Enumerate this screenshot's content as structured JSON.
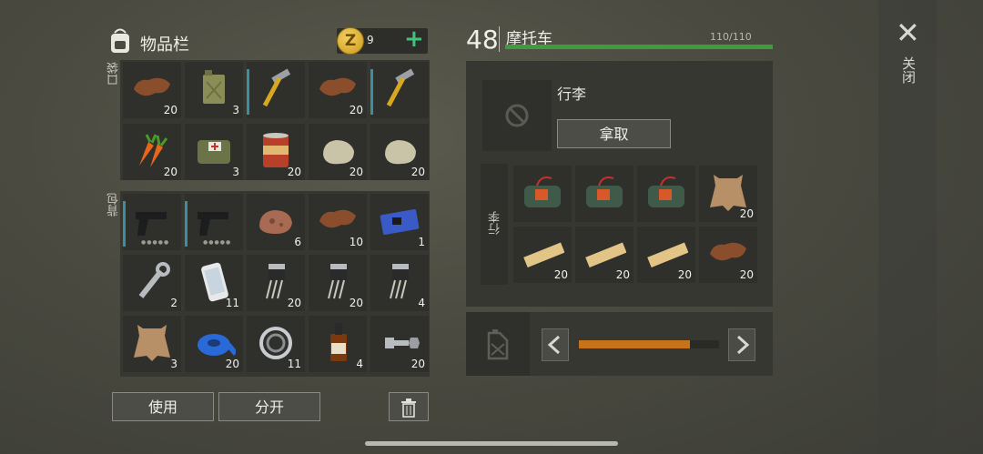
{
  "inventory": {
    "title": "物品栏",
    "coins": "9",
    "coin_symbol": "Z",
    "plus": "+",
    "pockets_label": "口袋",
    "backpack_label": "背包",
    "pockets": [
      {
        "item": "leather",
        "count": "20"
      },
      {
        "item": "jerrycan",
        "count": "3"
      },
      {
        "item": "hammer",
        "count": ""
      },
      {
        "item": "leather",
        "count": "20"
      },
      {
        "item": "hammer",
        "count": ""
      },
      {
        "item": "carrots",
        "count": "20"
      },
      {
        "item": "first-aid-bag",
        "count": "3"
      },
      {
        "item": "food-can",
        "count": "20"
      },
      {
        "item": "stone",
        "count": "20"
      },
      {
        "item": "stone",
        "count": "20"
      }
    ],
    "backpack": [
      {
        "item": "pistol",
        "count": ""
      },
      {
        "item": "pistol",
        "count": ""
      },
      {
        "item": "copper-ore",
        "count": "6"
      },
      {
        "item": "leather",
        "count": "10"
      },
      {
        "item": "circuit-board",
        "count": "1"
      },
      {
        "item": "wrench",
        "count": "2"
      },
      {
        "item": "smartphone",
        "count": "11"
      },
      {
        "item": "transistor",
        "count": "20"
      },
      {
        "item": "transistor",
        "count": "20"
      },
      {
        "item": "transistor",
        "count": "4"
      },
      {
        "item": "animal-hide",
        "count": "3"
      },
      {
        "item": "duct-tape",
        "count": "20"
      },
      {
        "item": "bearing",
        "count": "11"
      },
      {
        "item": "whiskey-bottle",
        "count": "4"
      },
      {
        "item": "bolt-nut",
        "count": "20"
      }
    ],
    "use_button": "使用",
    "split_button": "分开"
  },
  "vehicle": {
    "level": "48",
    "name": "摩托车",
    "hp_text": "110/110",
    "hp_fraction": 1.0,
    "luggage_title": "行李",
    "take_button": "拿取",
    "luggage_label": "行李",
    "luggage": [
      {
        "item": "dynamite-bundle",
        "count": ""
      },
      {
        "item": "dynamite-bundle",
        "count": ""
      },
      {
        "item": "dynamite-bundle",
        "count": ""
      },
      {
        "item": "animal-hide",
        "count": "20"
      },
      {
        "item": "wood-plank",
        "count": "20"
      },
      {
        "item": "wood-plank",
        "count": "20"
      },
      {
        "item": "wood-plank",
        "count": "20"
      },
      {
        "item": "leather",
        "count": "20"
      }
    ],
    "fuel_fraction": 0.79
  },
  "close_label": "关闭",
  "close_symbol": "✕"
}
